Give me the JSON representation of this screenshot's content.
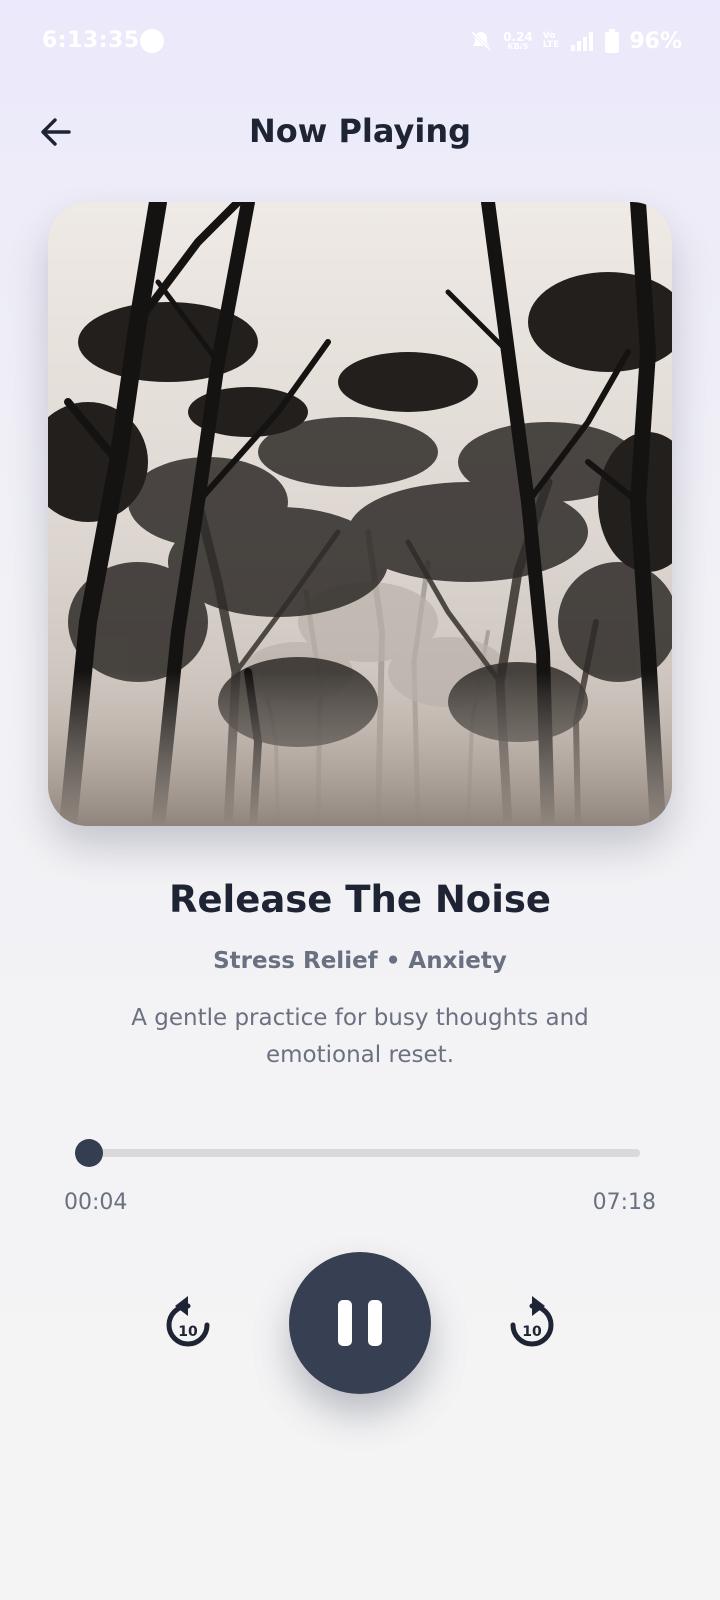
{
  "status_bar": {
    "time": "6:13:35",
    "net_speed_value": "0.24",
    "net_speed_unit": "KB/S",
    "volte_top": "Vo",
    "volte_bottom": "LTE",
    "battery": "96%"
  },
  "header": {
    "title": "Now Playing",
    "back_icon": "arrow-left-icon"
  },
  "track": {
    "title": "Release The Noise",
    "tags": "Stress Relief • Anxiety",
    "description": "A gentle practice for busy thoughts and emotional reset.",
    "artwork": "misty-forest-trees"
  },
  "player": {
    "elapsed": "00:04",
    "total": "07:18",
    "progress": 0.009,
    "rewind_label": "10",
    "forward_label": "10",
    "state": "playing"
  },
  "colors": {
    "primary_dark": "#373f52",
    "text_dark": "#1e2433",
    "text_muted": "#6b7180",
    "track_bg": "#d9d9dc"
  }
}
